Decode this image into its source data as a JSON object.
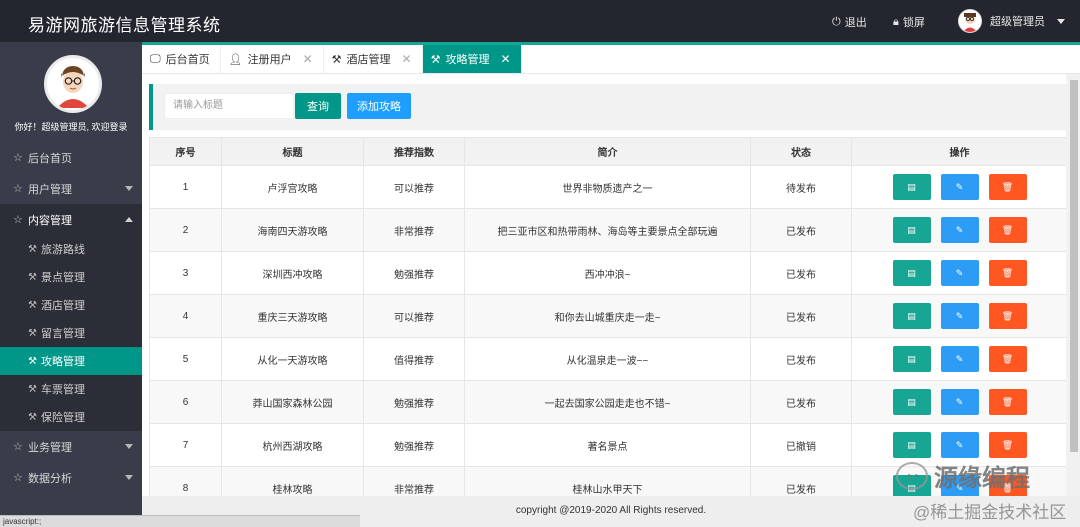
{
  "header": {
    "title": "易游网旅游信息管理系统",
    "logout": "退出",
    "lock": "锁屏",
    "username": "超级管理员"
  },
  "sidebar": {
    "welcome": "你好！超级管理员, 欢迎登录",
    "items": [
      {
        "label": "后台首页",
        "icon": "home-icon"
      },
      {
        "label": "用户管理",
        "icon": "user-icon"
      },
      {
        "label": "内容管理",
        "icon": "content-icon"
      },
      {
        "label": "业务管理",
        "icon": "business-icon"
      },
      {
        "label": "数据分析",
        "icon": "data-icon"
      }
    ],
    "sub_items": [
      "旅游路线",
      "景点管理",
      "酒店管理",
      "留言管理",
      "攻略管理",
      "车票管理",
      "保险管理"
    ]
  },
  "tabs": [
    {
      "label": "后台首页",
      "icon": "monitor-icon"
    },
    {
      "label": "注册用户",
      "icon": "person-icon"
    },
    {
      "label": "酒店管理",
      "icon": "tools-icon"
    },
    {
      "label": "攻略管理",
      "icon": "tools-icon"
    }
  ],
  "toolbar": {
    "search_placeholder": "请输入标题",
    "query_label": "查询",
    "add_label": "添加攻略"
  },
  "table": {
    "headers": [
      "序号",
      "标题",
      "推荐指数",
      "简介",
      "状态",
      "操作"
    ],
    "rows": [
      {
        "no": "1",
        "title": "卢浮宫攻略",
        "rec": "可以推荐",
        "intro": "世界非物质遗产之一",
        "status": "待发布"
      },
      {
        "no": "2",
        "title": "海南四天游攻略",
        "rec": "非常推荐",
        "intro": "把三亚市区和热带雨林、海岛等主要景点全部玩遍",
        "status": "已发布"
      },
      {
        "no": "3",
        "title": "深圳西冲攻略",
        "rec": "勉强推荐",
        "intro": "西冲冲浪~",
        "status": "已发布"
      },
      {
        "no": "4",
        "title": "重庆三天游攻略",
        "rec": "可以推荐",
        "intro": "和你去山城重庆走一走~",
        "status": "已发布"
      },
      {
        "no": "5",
        "title": "从化一天游攻略",
        "rec": "值得推荐",
        "intro": "从化温泉走一波~~",
        "status": "已发布"
      },
      {
        "no": "6",
        "title": "莽山国家森林公园",
        "rec": "勉强推荐",
        "intro": "一起去国家公园走走也不错~",
        "status": "已发布"
      },
      {
        "no": "7",
        "title": "杭州西湖攻略",
        "rec": "勉强推荐",
        "intro": "著名景点",
        "status": "已撤销"
      },
      {
        "no": "8",
        "title": "桂林攻略",
        "rec": "非常推荐",
        "intro": "桂林山水甲天下",
        "status": "已发布"
      }
    ]
  },
  "footer": "copyright @2019-2020 All Rights reserved.",
  "statusbar": "javascript:;",
  "watermark": {
    "line1": "源缘编程",
    "line2": "@稀土掘金技术社区"
  },
  "colors": {
    "primary": "#009688",
    "blue": "#1e9fff",
    "danger": "#ff5722",
    "sidebar": "#393d49",
    "header": "#23262e"
  }
}
